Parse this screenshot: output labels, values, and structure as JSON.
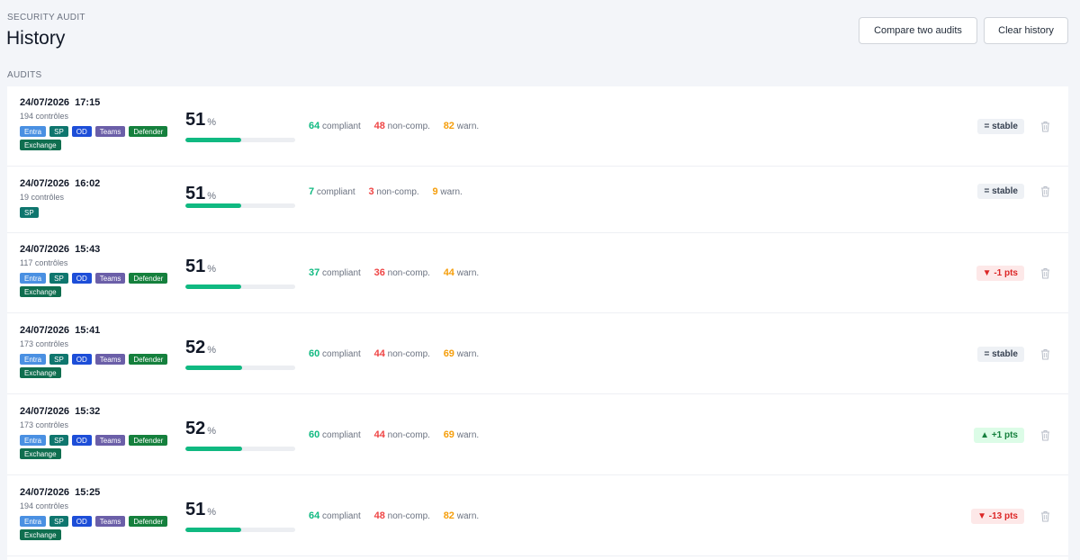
{
  "header": {
    "eyebrow": "SECURITY AUDIT",
    "title": "History",
    "compare_label": "Compare two audits",
    "clear_label": "Clear history"
  },
  "section_label": "AUDITS",
  "labels": {
    "compliant": "compliant",
    "noncompliant": "non-comp.",
    "warning": "warn.",
    "percent": "%"
  },
  "audits": [
    {
      "date": "24/07/2026  17:15",
      "controls": "194 contrôles",
      "tags": [
        "Entra",
        "SP",
        "OD",
        "Teams",
        "Defender",
        "Exchange"
      ],
      "score": "51",
      "score_fraction": 0.51,
      "compliant": "64",
      "noncompliant": "48",
      "warning": "82",
      "trend": "= stable",
      "trend_kind": "stable"
    },
    {
      "date": "24/07/2026  16:02",
      "controls": "19 contrôles",
      "tags": [
        "SP"
      ],
      "score": "51",
      "score_fraction": 0.51,
      "compliant": "7",
      "noncompliant": "3",
      "warning": "9",
      "trend": "= stable",
      "trend_kind": "stable"
    },
    {
      "date": "24/07/2026  15:43",
      "controls": "117 contrôles",
      "tags": [
        "Entra",
        "SP",
        "OD",
        "Teams",
        "Defender",
        "Exchange"
      ],
      "score": "51",
      "score_fraction": 0.51,
      "compliant": "37",
      "noncompliant": "36",
      "warning": "44",
      "trend": "▼ -1 pts",
      "trend_kind": "down"
    },
    {
      "date": "24/07/2026  15:41",
      "controls": "173 contrôles",
      "tags": [
        "Entra",
        "SP",
        "OD",
        "Teams",
        "Defender",
        "Exchange"
      ],
      "score": "52",
      "score_fraction": 0.52,
      "compliant": "60",
      "noncompliant": "44",
      "warning": "69",
      "trend": "= stable",
      "trend_kind": "stable"
    },
    {
      "date": "24/07/2026  15:32",
      "controls": "173 contrôles",
      "tags": [
        "Entra",
        "SP",
        "OD",
        "Teams",
        "Defender",
        "Exchange"
      ],
      "score": "52",
      "score_fraction": 0.52,
      "compliant": "60",
      "noncompliant": "44",
      "warning": "69",
      "trend": "▲ +1 pts",
      "trend_kind": "up"
    },
    {
      "date": "24/07/2026  15:25",
      "controls": "194 contrôles",
      "tags": [
        "Entra",
        "SP",
        "OD",
        "Teams",
        "Defender",
        "Exchange"
      ],
      "score": "51",
      "score_fraction": 0.51,
      "compliant": "64",
      "noncompliant": "48",
      "warning": "82",
      "trend": "▼ -13 pts",
      "trend_kind": "down"
    }
  ],
  "icons": {
    "delete": "trash-icon"
  }
}
